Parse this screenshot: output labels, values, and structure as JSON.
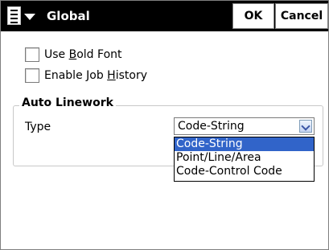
{
  "titlebar": {
    "title": "Global",
    "menu_icon": "document-menu-icon",
    "ok_label": "OK",
    "cancel_label": "Cancel"
  },
  "options": {
    "bold_font": {
      "label_pre": "Use ",
      "label_key": "B",
      "label_post": "old Font",
      "checked": false
    },
    "job_history": {
      "label_pre": "Enable Job ",
      "label_key": "H",
      "label_post": "istory",
      "checked": false
    }
  },
  "auto_linework": {
    "group_title": "Auto Linework",
    "type_label": "Type",
    "selected_value": "Code-String",
    "options": [
      "Code-String",
      "Point/Line/Area",
      "Code-Control Code"
    ],
    "highlighted_index": 0
  },
  "colors": {
    "titlebar_bg": "#000000",
    "highlight": "#3164c9"
  }
}
